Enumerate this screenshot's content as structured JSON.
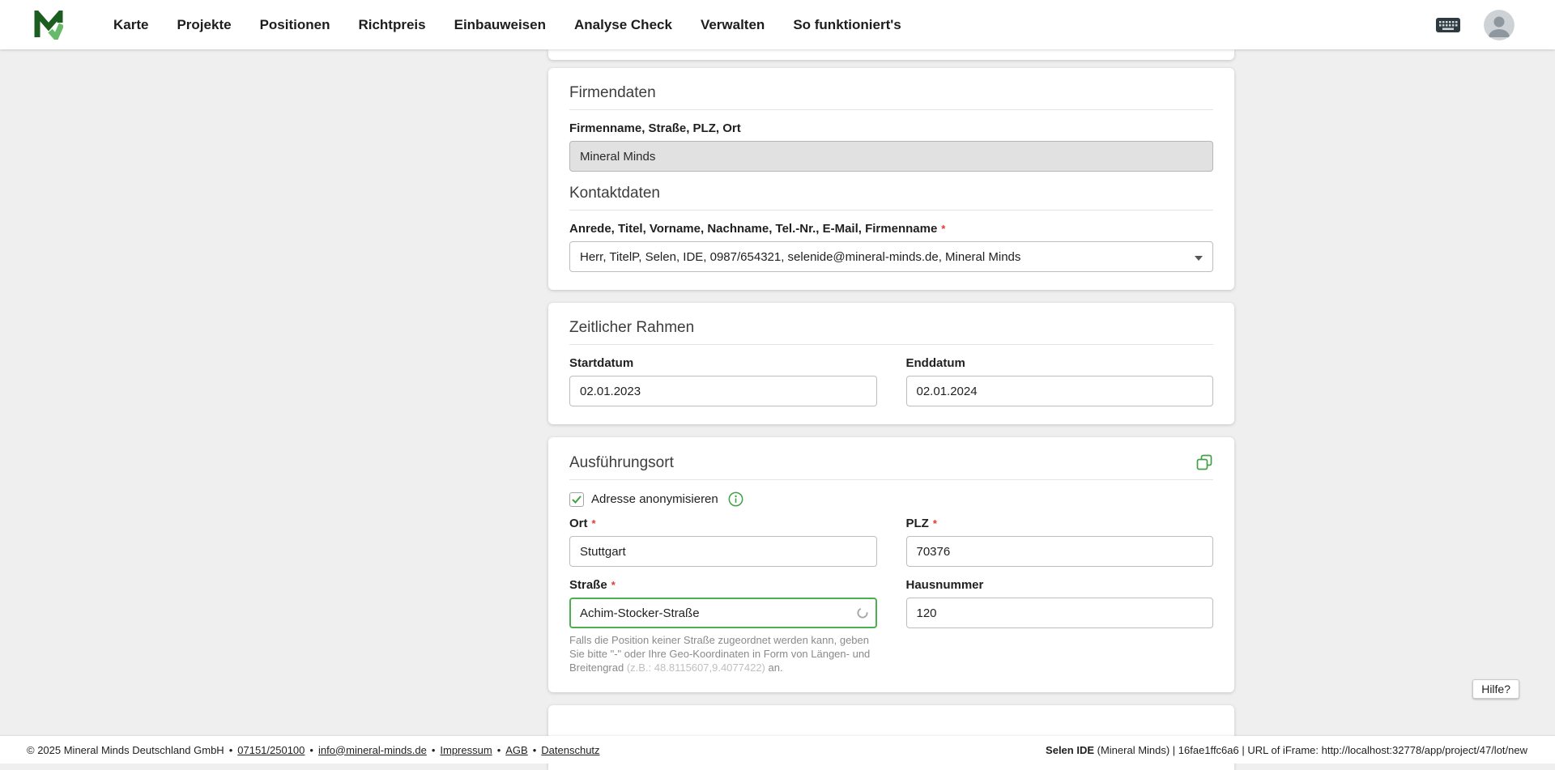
{
  "nav": {
    "items": [
      "Karte",
      "Projekte",
      "Positionen",
      "Richtpreis",
      "Einbauweisen",
      "Analyse Check",
      "Verwalten",
      "So funktioniert's"
    ]
  },
  "firmendaten": {
    "title": "Firmendaten",
    "field_label": "Firmenname, Straße, PLZ, Ort",
    "field_value": "Mineral Minds",
    "kontakt_title": "Kontaktdaten",
    "kontakt_label": "Anrede, Titel, Vorname, Nachname, Tel.-Nr., E-Mail, Firmenname",
    "kontakt_value": "Herr, TitelP, Selen, IDE, 0987/654321, selenide@mineral-minds.de, Mineral Minds"
  },
  "zeitlicher_rahmen": {
    "title": "Zeitlicher Rahmen",
    "start_label": "Startdatum",
    "start_value": "02.01.2023",
    "end_label": "Enddatum",
    "end_value": "02.01.2024"
  },
  "ausfuehrungsort": {
    "title": "Ausführungsort",
    "anonymize_label": "Adresse anonymisieren",
    "ort_label": "Ort",
    "ort_value": "Stuttgart",
    "plz_label": "PLZ",
    "plz_value": "70376",
    "strasse_label": "Straße",
    "strasse_value": "Achim-Stocker-Straße",
    "hausnummer_label": "Hausnummer",
    "hausnummer_value": "120",
    "hint_text": "Falls die Position keiner Straße zugeordnet werden kann, geben Sie bitte \"-\" oder Ihre Geo-Koordinaten in Form von Längen- und Breitengrad ",
    "hint_coords": "(z.B.: 48.8115607,9.4077422)",
    "hint_suffix": " an."
  },
  "help": {
    "label": "Hilfe?"
  },
  "footer": {
    "copyright": "© 2025 Mineral Minds Deutschland GmbH",
    "separator": "•",
    "phone": "07151/250100",
    "email": "info@mineral-minds.de",
    "impressum": "Impressum",
    "agb": "AGB",
    "datenschutz": "Datenschutz",
    "right_app": "Selen IDE",
    "right_rest": " (Mineral Minds) | 16fae1ffc6a6 | URL of iFrame: http://localhost:32778/app/project/47/lot/new"
  },
  "misc": {
    "required": "*"
  },
  "colors": {
    "accent_green": "#43a047",
    "focus_border": "#4caf50",
    "required_red": "#e53935",
    "page_background": "#efefef",
    "card_background": "#ffffff"
  }
}
